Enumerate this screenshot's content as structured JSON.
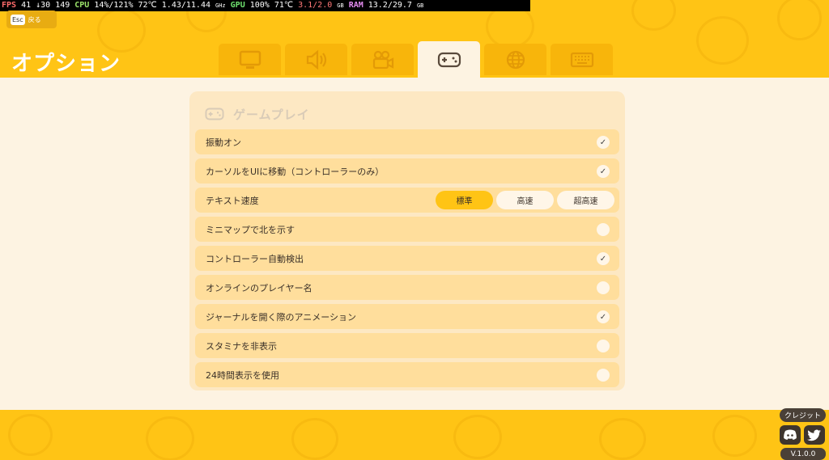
{
  "overlay": {
    "fps_label": "FPS",
    "fps_value": "41",
    "fps_lows": "↓30 149",
    "cpu_label": "CPU",
    "cpu_value": "14%/121%",
    "cpu_temp": "72℃",
    "cpu_clock": "1.43/11.44",
    "cpu_clock_unit": "GHz",
    "gpu_label": "GPU",
    "gpu_value": "100% 71℃",
    "gpu_mem": "3.1/2.0",
    "gpu_mem_unit": "GB",
    "ram_label": "RAM",
    "ram_value": "13.2/29.7",
    "ram_unit": "GB"
  },
  "back": {
    "key": "Esc",
    "label": "戻る"
  },
  "page_title": "オプション",
  "tabs": [
    {
      "icon": "monitor-icon"
    },
    {
      "icon": "speaker-icon"
    },
    {
      "icon": "video-camera-icon"
    },
    {
      "icon": "gamepad-icon",
      "active": true
    },
    {
      "icon": "globe-icon"
    },
    {
      "icon": "keyboard-icon"
    }
  ],
  "panel": {
    "title": "ゲームプレイ",
    "icon": "gamepad-icon",
    "rows": [
      {
        "label": "振動オン",
        "checked": true
      },
      {
        "label": "カーソルをUIに移動（コントローラーのみ）",
        "checked": true
      },
      {
        "label": "テキスト速度",
        "options": [
          "標準",
          "高速",
          "超高速"
        ],
        "selected": "標準"
      },
      {
        "label": "ミニマップで北を示す",
        "checked": false
      },
      {
        "label": "コントローラー自動検出",
        "checked": true
      },
      {
        "label": "オンラインのプレイヤー名",
        "checked": false
      },
      {
        "label": "ジャーナルを開く際のアニメーション",
        "checked": true
      },
      {
        "label": "スタミナを非表示",
        "checked": false
      },
      {
        "label": "24時間表示を使用",
        "checked": false
      }
    ]
  },
  "footer": {
    "credit_label": "クレジット",
    "social": [
      "discord-icon",
      "twitter-icon"
    ],
    "version": "V.1.0.0"
  },
  "colors": {
    "accent": "#ffc415",
    "panel": "#fde8c3",
    "row": "#ffde9c",
    "background": "#fdf3e2"
  }
}
